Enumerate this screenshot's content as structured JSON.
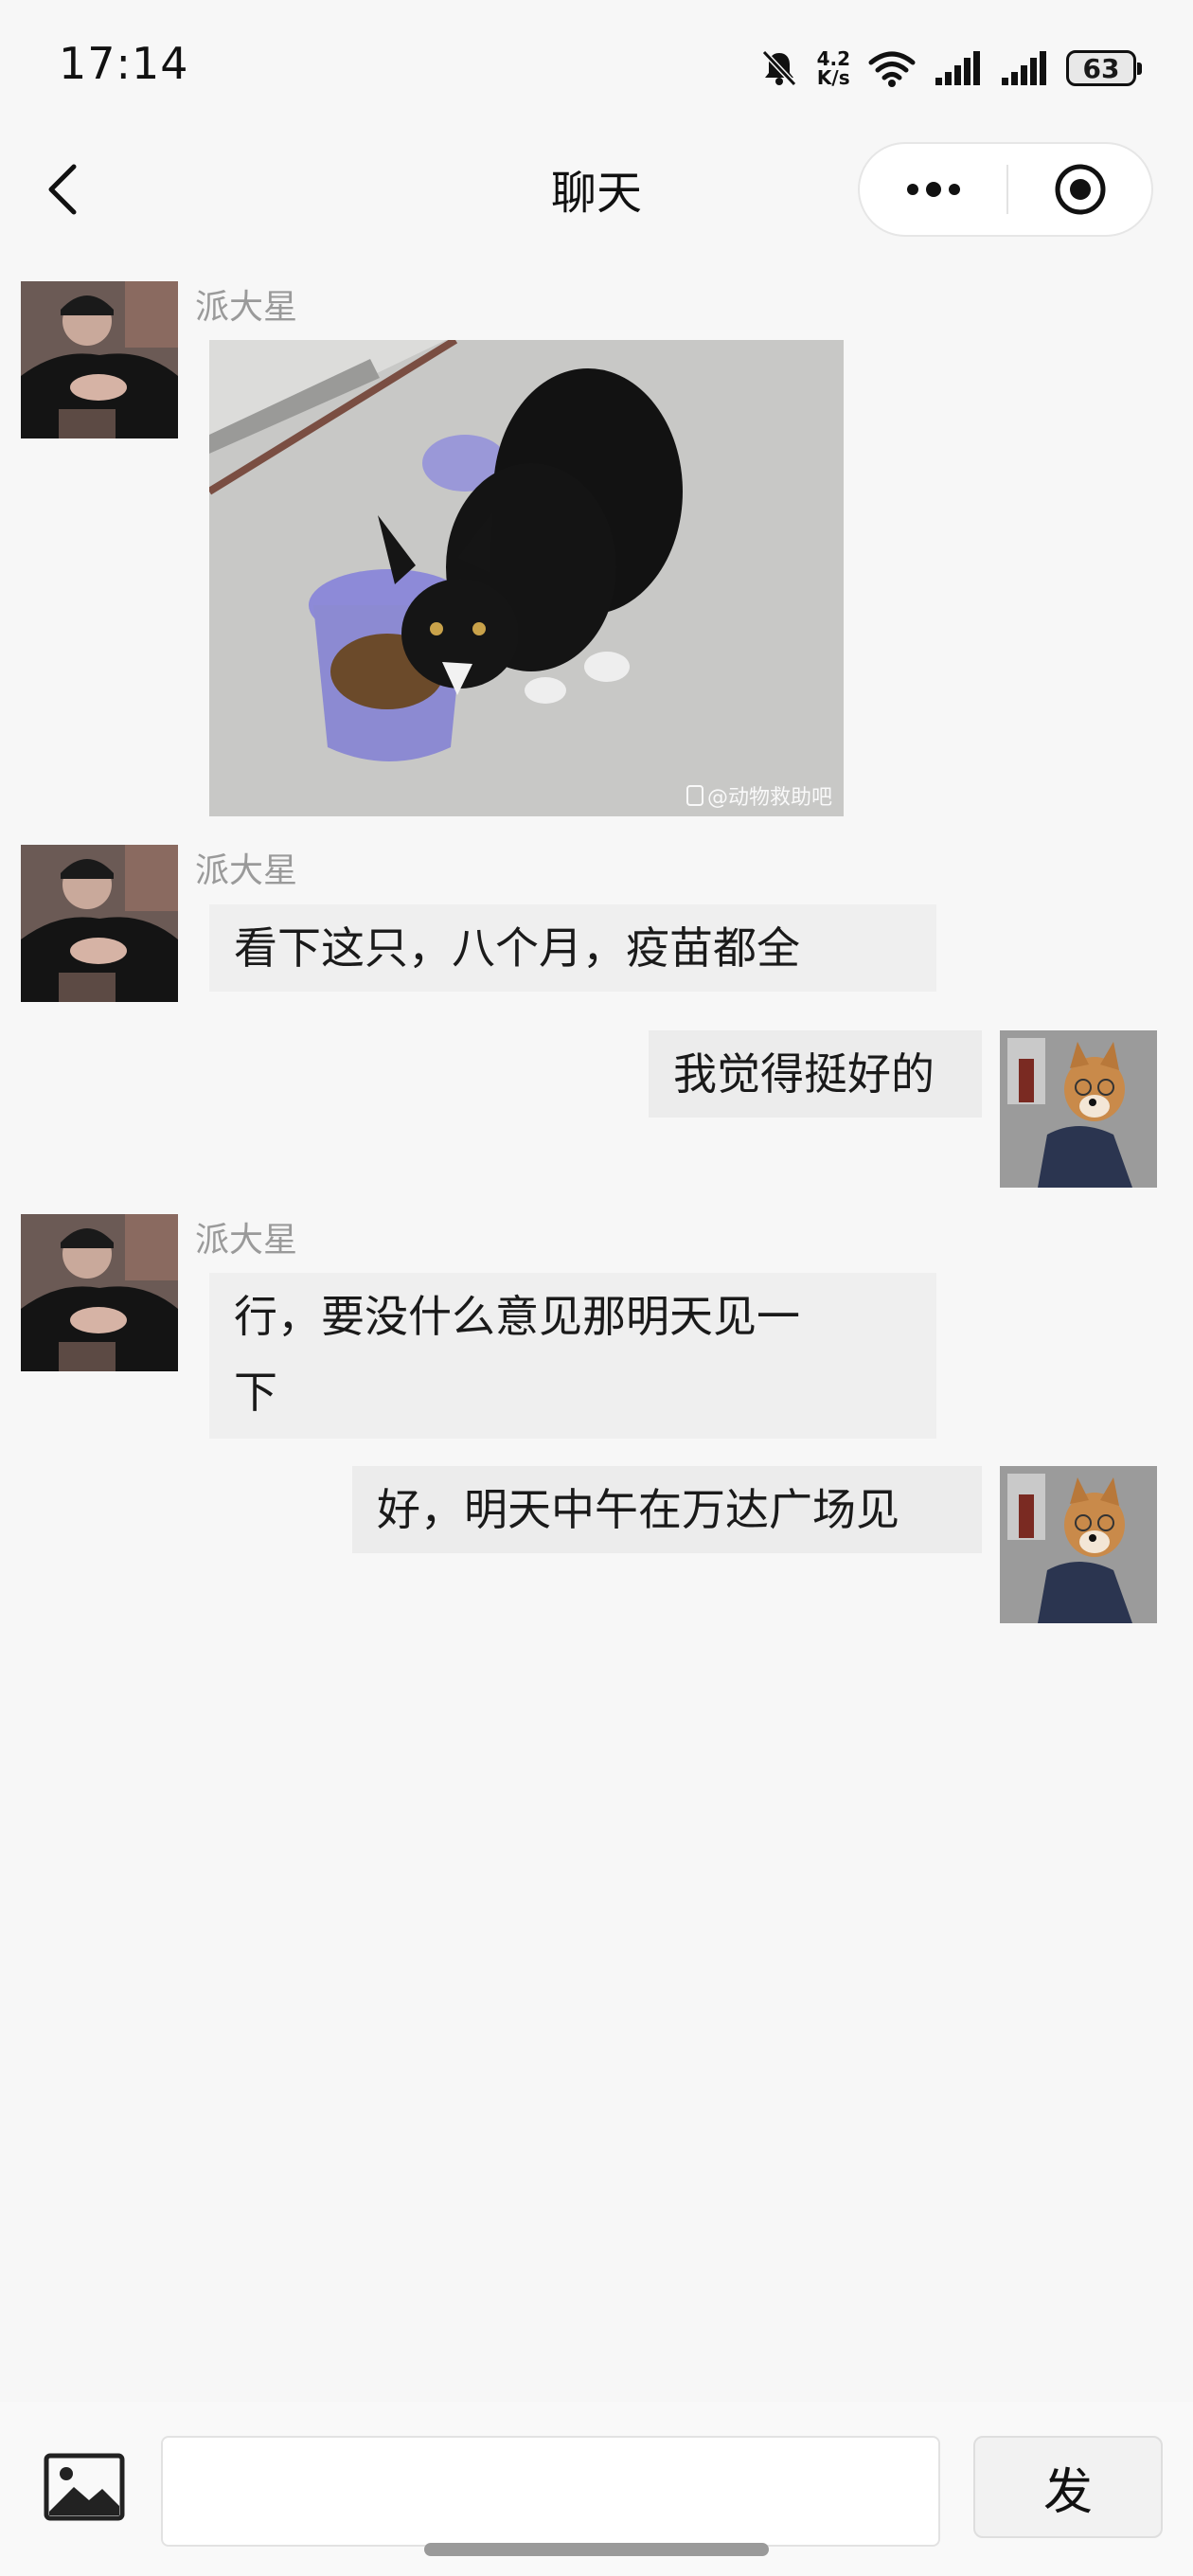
{
  "status_bar": {
    "time": "17:14",
    "net_speed_value": "4.2",
    "net_speed_unit": "K/s",
    "battery": "63",
    "icons": [
      "bell-muted-icon",
      "wifi-icon",
      "signal-icon",
      "signal-icon",
      "battery-icon"
    ]
  },
  "nav": {
    "title": "聊天",
    "back_icon": "chevron-left-icon",
    "more_icon": "more-dots-icon",
    "close_icon": "target-circle-icon"
  },
  "messages": [
    {
      "side": "left",
      "sender": "派大星",
      "type": "image",
      "image": "black-cat-eating-photo",
      "watermark": "@动物救助吧"
    },
    {
      "side": "left",
      "sender": "派大星",
      "type": "text",
      "text": "看下这只，八个月，疫苗都全"
    },
    {
      "side": "right",
      "type": "text",
      "text": "我觉得挺好的"
    },
    {
      "side": "left",
      "sender": "派大星",
      "type": "text",
      "text_line1": "行，要没什么意见那明天见一",
      "text_line2": "下"
    },
    {
      "side": "right",
      "type": "text",
      "text": "好，明天中午在万达广场见"
    }
  ],
  "input_bar": {
    "image_icon": "image-icon",
    "input_value": "",
    "input_placeholder": "",
    "send_label": "发"
  },
  "colors": {
    "background": "#f7f7f7",
    "bubble": "#efefef",
    "name": "#9a9a9a",
    "text": "#1a1a1a"
  }
}
